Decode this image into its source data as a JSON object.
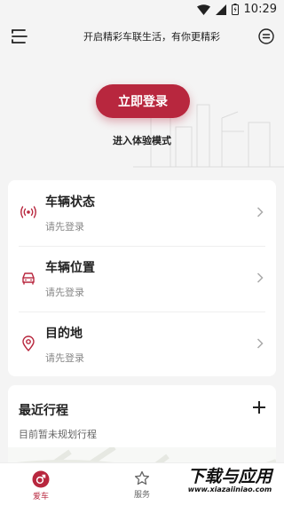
{
  "status_bar": {
    "time": "10:29"
  },
  "header": {
    "title": "开启精彩车联生活，有你更精彩"
  },
  "hero": {
    "login_label": "立即登录",
    "trial_label": "进入体验模式"
  },
  "vehicle_items": [
    {
      "title": "车辆状态",
      "subtitle": "请先登录",
      "icon": "signal-icon"
    },
    {
      "title": "车辆位置",
      "subtitle": "请先登录",
      "icon": "car-icon"
    },
    {
      "title": "目的地",
      "subtitle": "请先登录",
      "icon": "location-pin-icon"
    }
  ],
  "recent_trips": {
    "title": "最近行程",
    "empty_text": "目前暂未规划行程"
  },
  "tabs": [
    {
      "label": "爱车",
      "icon": "car-tab-icon",
      "active": true
    },
    {
      "label": "服务",
      "icon": "star-icon",
      "active": false
    }
  ],
  "watermark": {
    "cn": "下载与应用",
    "url": "www.xiazaiiniao.com"
  },
  "colors": {
    "accent": "#b8273e",
    "background": "#f4f4f4"
  }
}
